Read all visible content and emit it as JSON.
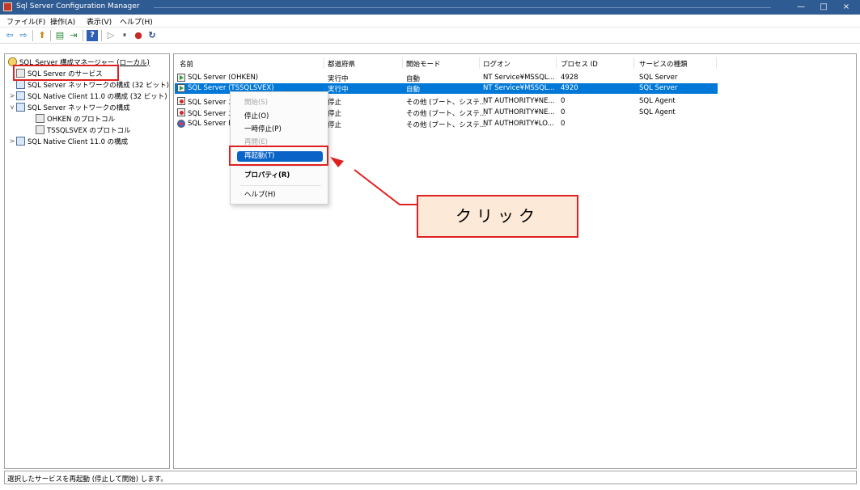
{
  "window": {
    "title": "Sql Server Configuration Manager",
    "controls": {
      "minimize": "—",
      "maximize": "□",
      "close": "×"
    }
  },
  "menubar": [
    "ファイル(F)",
    "操作(A)",
    "表示(V)",
    "ヘルプ(H)"
  ],
  "toolbar": {
    "icons": [
      "back-icon",
      "forward-icon",
      "up-folder-icon",
      "properties-icon",
      "export-icon",
      "help-icon",
      "start-icon",
      "pause-icon",
      "stop-icon",
      "restart-icon"
    ],
    "glyphs": {
      "back": "⇦",
      "forward": "⇨",
      "up": "⬆",
      "props": "▤",
      "export": "⇥",
      "help": "?",
      "start": "▷",
      "pause": "⏸",
      "stop": "●",
      "restart": "↻"
    }
  },
  "tree": {
    "root": "SQL Server 構成マネージャー (ローカル)",
    "items": [
      {
        "label": "SQL Server のサービス",
        "expand": ""
      },
      {
        "label": "SQL Server ネットワークの構成 (32 ビット)",
        "expand": ""
      },
      {
        "label": "SQL Native Client 11.0 の構成 (32 ビット)",
        "expand": ">"
      },
      {
        "label": "SQL Server ネットワークの構成",
        "expand": "v"
      },
      {
        "label": "OHKEN のプロトコル",
        "expand": ""
      },
      {
        "label": "TSSQLSVEX のプロトコル",
        "expand": ""
      },
      {
        "label": "SQL Native Client 11.0 の構成",
        "expand": ">"
      }
    ]
  },
  "list": {
    "columns": [
      "名前",
      "都道府県",
      "開始モード",
      "ログオン",
      "プロセス ID",
      "サービスの種類"
    ],
    "rows": [
      {
        "name": "SQL Server (OHKEN)",
        "state": "実行中",
        "mode": "自動",
        "logon": "NT Service¥MSSQL...",
        "pid": "4928",
        "type": "SQL Server",
        "icon": "run"
      },
      {
        "name": "SQL Server (TSSQLSVEX)",
        "state": "実行中",
        "mode": "自動",
        "logon": "NT Service¥MSSQL...",
        "pid": "4920",
        "type": "SQL Server",
        "icon": "run"
      },
      {
        "name": "SQL Server エ",
        "state": "停止",
        "mode": "その他 (ブート、システ...",
        "logon": "NT AUTHORITY¥NE...",
        "pid": "0",
        "type": "SQL Agent",
        "icon": "stop"
      },
      {
        "name": "SQL Server エ",
        "state": "停止",
        "mode": "その他 (ブート、システ...",
        "logon": "NT AUTHORITY¥NE...",
        "pid": "0",
        "type": "SQL Agent",
        "icon": "stop"
      },
      {
        "name": "SQL Server B",
        "state": "停止",
        "mode": "その他 (ブート、システ...",
        "logon": "NT AUTHORITY¥LO...",
        "pid": "0",
        "type": "",
        "icon": "browser"
      }
    ]
  },
  "context_menu": {
    "items": [
      "開始(S)",
      "停止(O)",
      "一時停止(P)",
      "再開(E)",
      "再起動(T)",
      "プロパティ(R)",
      "ヘルプ(H)"
    ]
  },
  "callout": {
    "text": "クリック"
  },
  "statusbar": {
    "text": "選択したサービスを再起動 (停止して開始) します。"
  }
}
